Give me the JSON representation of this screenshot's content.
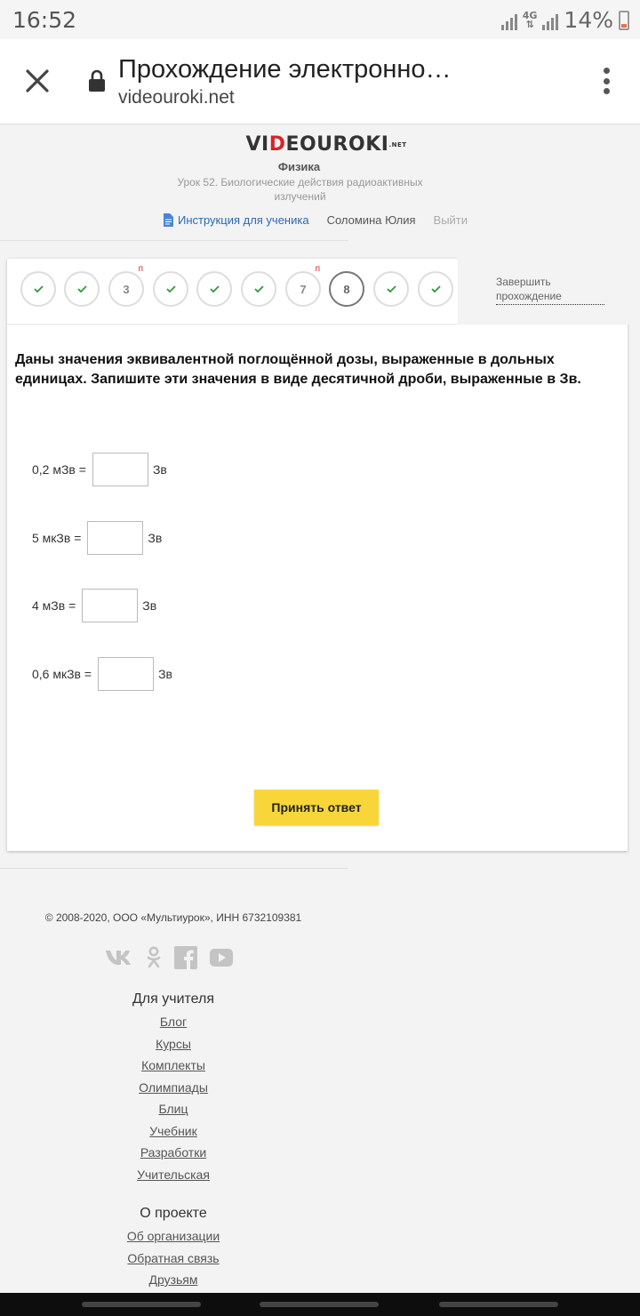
{
  "status_bar": {
    "time": "16:52",
    "network": "4G",
    "battery": "14%"
  },
  "browser": {
    "title": "Прохождение электронно…",
    "url": "videouroki.net"
  },
  "site": {
    "logo_left": "VI",
    "logo_red": "D",
    "logo_right": "EOUROKI",
    "logo_sup": ".NET",
    "subject": "Физика",
    "lesson": "Урок 52. Биологические действия радиоактивных излучений",
    "instruction_link": "Инструкция для ученика",
    "user_name": "Соломина Юлия",
    "logout": "Выйти"
  },
  "question_nav": {
    "items": [
      {
        "label": "",
        "state": "done"
      },
      {
        "label": "",
        "state": "done"
      },
      {
        "label": "3",
        "state": "pending",
        "badge": "п"
      },
      {
        "label": "",
        "state": "done"
      },
      {
        "label": "",
        "state": "done"
      },
      {
        "label": "",
        "state": "done"
      },
      {
        "label": "7",
        "state": "pending",
        "badge": "п"
      },
      {
        "label": "8",
        "state": "current"
      },
      {
        "label": "",
        "state": "done"
      },
      {
        "label": "",
        "state": "done"
      }
    ],
    "finish_label": "Завершить прохождение"
  },
  "question": {
    "text": "Даны значения эквивалентной поглощённой дозы, выраженные в дольных единицах. Запишите эти значения в виде десятичной дроби, выраженные в Зв.",
    "rows": [
      {
        "label": "0,2 мЗв =",
        "unit": "Зв",
        "value": ""
      },
      {
        "label": "5 мкЗв =",
        "unit": "Зв",
        "value": ""
      },
      {
        "label": "4 мЗв =",
        "unit": "Зв",
        "value": ""
      },
      {
        "label": "0,6 мкЗв =",
        "unit": "Зв",
        "value": ""
      }
    ],
    "submit_label": "Принять ответ"
  },
  "footer": {
    "copyright": "© 2008-2020, ООО «Мультиурок», ИНН 6732109381",
    "teacher_heading": "Для учителя",
    "teacher_links": [
      "Блог",
      "Курсы",
      "Комплекты",
      "Олимпиады",
      "Блиц",
      "Учебник",
      "Разработки",
      "Учительская"
    ],
    "project_heading": "О проекте",
    "project_links": [
      "Об организации",
      "Обратная связь",
      "Друзьям"
    ]
  },
  "colors": {
    "accent_yellow": "#f8d63a",
    "link_blue": "#2a6ab0",
    "check_green": "#2e9a3a",
    "brand_red": "#d8232a"
  }
}
